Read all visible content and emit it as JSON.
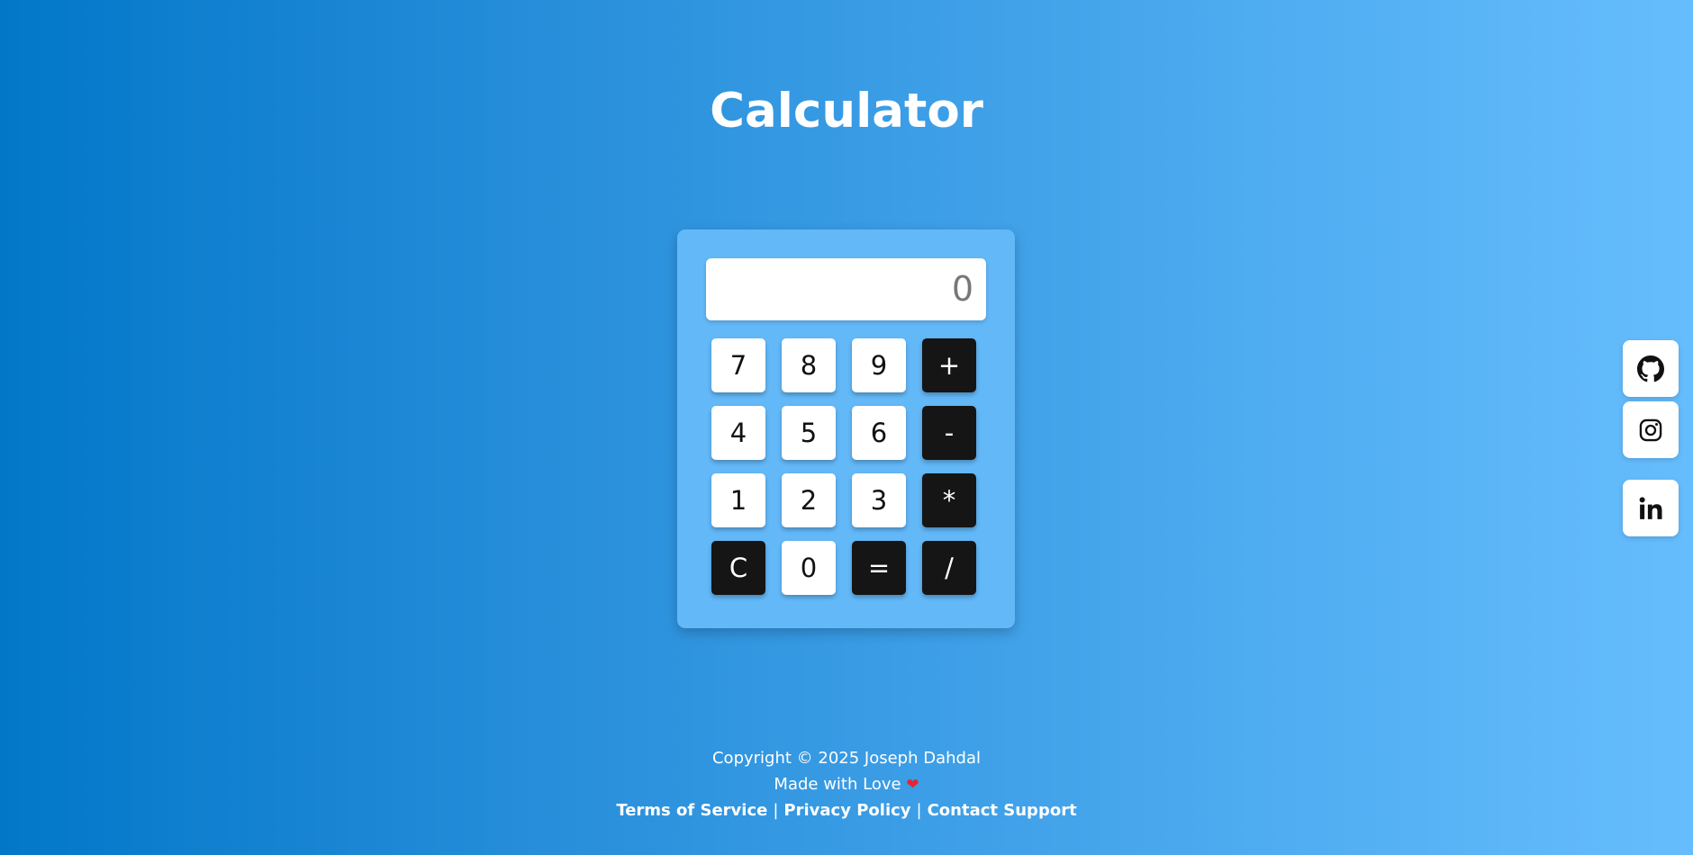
{
  "page": {
    "title": "Calculator"
  },
  "calculator": {
    "display_value": "0",
    "keys": [
      {
        "label": "7",
        "style": "light",
        "name": "key-7"
      },
      {
        "label": "8",
        "style": "light",
        "name": "key-8"
      },
      {
        "label": "9",
        "style": "light",
        "name": "key-9"
      },
      {
        "label": "+",
        "style": "dark",
        "name": "key-add"
      },
      {
        "label": "4",
        "style": "light",
        "name": "key-4"
      },
      {
        "label": "5",
        "style": "light",
        "name": "key-5"
      },
      {
        "label": "6",
        "style": "light",
        "name": "key-6"
      },
      {
        "label": "-",
        "style": "dark",
        "name": "key-subtract"
      },
      {
        "label": "1",
        "style": "light",
        "name": "key-1"
      },
      {
        "label": "2",
        "style": "light",
        "name": "key-2"
      },
      {
        "label": "3",
        "style": "light",
        "name": "key-3"
      },
      {
        "label": "*",
        "style": "dark",
        "name": "key-multiply"
      },
      {
        "label": "C",
        "style": "dark",
        "name": "key-clear"
      },
      {
        "label": "0",
        "style": "light",
        "name": "key-0"
      },
      {
        "label": "=",
        "style": "dark",
        "name": "key-equals"
      },
      {
        "label": "/",
        "style": "dark",
        "name": "key-divide"
      }
    ]
  },
  "social": [
    {
      "icon": "github-icon"
    },
    {
      "icon": "instagram-icon"
    },
    {
      "icon": "linkedin-icon"
    }
  ],
  "footer": {
    "copyright": "Copyright © 2025 Joseph Dahdal",
    "made_with": "Made with Love",
    "heart_icon": "heart-icon",
    "links": {
      "terms": "Terms of Service",
      "privacy": "Privacy Policy",
      "contact": "Contact Support",
      "separator": "|"
    }
  },
  "colors": {
    "background_start": "#0277c8",
    "background_end": "#66bdfd",
    "calculator_body": "#63b8f8",
    "operator_key": "#151515",
    "digit_key": "#ffffff",
    "heart": "#e8252f"
  }
}
